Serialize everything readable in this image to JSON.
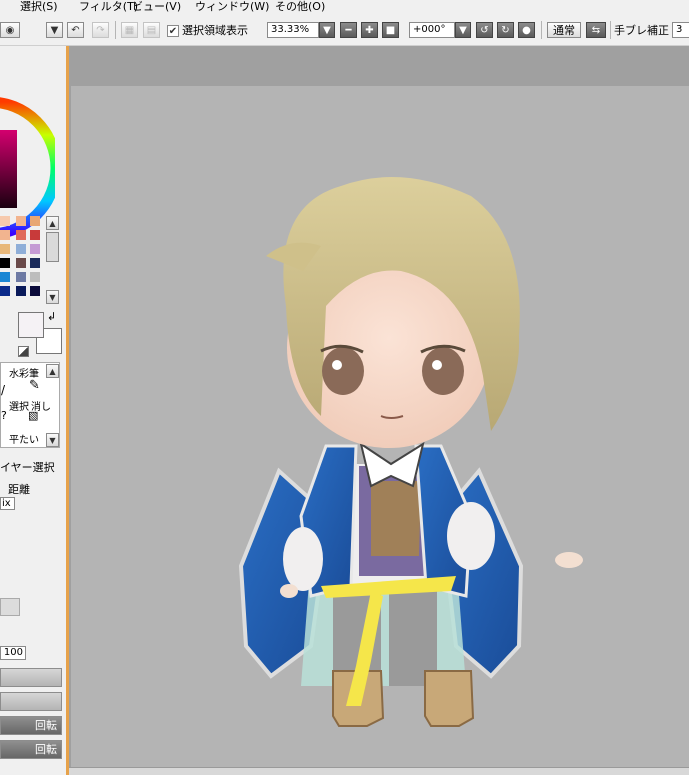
{
  "menu": {
    "select": "選択(S)",
    "filter": "フィルタ(T)",
    "view": "ビュー(V)",
    "window": "ウィンドウ(W)",
    "other": "その他(O)"
  },
  "toolbar": {
    "show_selection_label": "選択領域表示",
    "show_selection_checked": true,
    "zoom_value": "33.33%",
    "rotation_value": "+000°",
    "blend_mode": "通常",
    "stabilizer_label": "手ブレ補正",
    "stabilizer_value": "3"
  },
  "left_panel": {
    "brush_watercolor": "水彩筆",
    "brush_selection": "選択",
    "brush_eraser": "消し",
    "brush_flat": "平たい",
    "layer_select": "イヤー選択",
    "distance_label": "距離",
    "mix_label": "ix",
    "value_100": "100",
    "rotate_btn_1": "回転",
    "rotate_btn_2": "回転"
  },
  "colors": {
    "accent_border": "#e7a24a",
    "canvas_bg": "#b4b4b4",
    "workspace_bg": "#a0a0a0"
  }
}
